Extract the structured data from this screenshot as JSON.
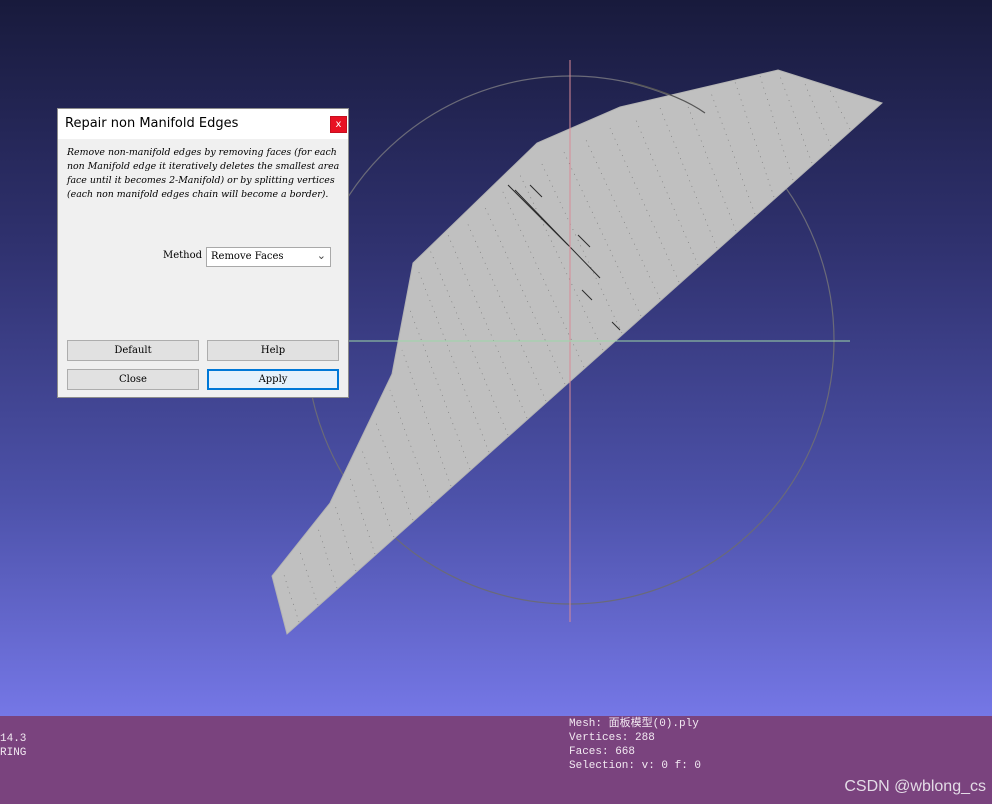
{
  "dialog": {
    "title": "Repair non Manifold Edges",
    "close_glyph": "x",
    "description": "Remove non-manifold edges by removing faces (for each non Manifold edge it iteratively deletes the smallest area face until it becomes 2-Manifold) or by splitting vertices (each non manifold edges chain will become a border).",
    "method_label": "Method",
    "method_value": "Remove Faces",
    "buttons": {
      "default": "Default",
      "help": "Help",
      "close": "Close",
      "apply": "Apply"
    }
  },
  "info": {
    "left_lines": [
      "14.3",
      "RING"
    ],
    "mesh_line": "Mesh: 面板模型(0).ply",
    "vertices_line": "Vertices: 288",
    "faces_line": "Faces: 668",
    "selection_line": "Selection: v: 0 f: 0"
  },
  "watermark": "CSDN @wblong_cs",
  "colors": {
    "background_top": "#181a3c",
    "background_bottom": "#7577e6",
    "mesh_fill": "#c0c0c0",
    "info_bar": "#7a437e",
    "close_button": "#e81123",
    "focus_border": "#0078d7"
  }
}
